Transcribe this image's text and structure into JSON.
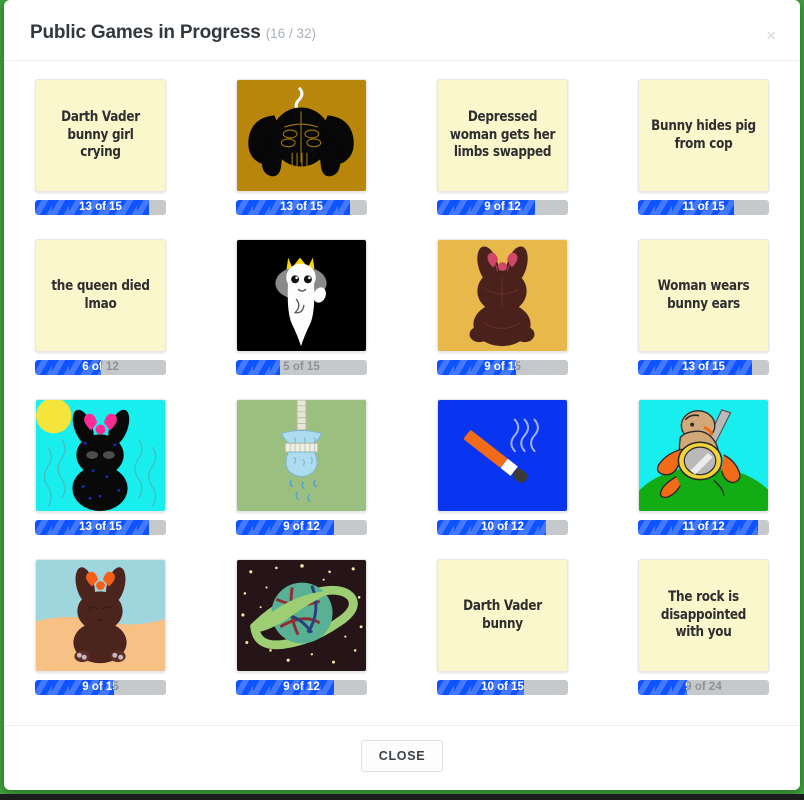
{
  "header": {
    "title": "Public Games in Progress",
    "count": "(16 / 32)",
    "close_icon": "close-icon",
    "close_icon_glyph": "×"
  },
  "footer": {
    "close_label": "CLOSE"
  },
  "colors": {
    "progress_fill": "#0f53ff",
    "progress_track": "#c6c9cc",
    "card_paper": "#fbf7cd",
    "title_text": "#32383e",
    "count_text": "#a9b0b7",
    "page_background": "#3fa13f"
  },
  "cards": [
    {
      "kind": "text",
      "text": "Darth Vader bunny girl crying",
      "progress_label": "13 of 15",
      "done": 13,
      "total": 15
    },
    {
      "kind": "drawing",
      "art": "spider-bomb",
      "progress_label": "13 of 15",
      "done": 13,
      "total": 15
    },
    {
      "kind": "text",
      "text": "Depressed woman gets her limbs swapped",
      "progress_label": "9 of 12",
      "done": 9,
      "total": 12
    },
    {
      "kind": "text",
      "text": "Bunny hides pig from cop",
      "progress_label": "11 of 15",
      "done": 11,
      "total": 15
    },
    {
      "kind": "text",
      "text": "the queen died lmao",
      "progress_label": "6 of 12",
      "done": 6,
      "total": 12
    },
    {
      "kind": "drawing",
      "art": "crowned-ghost",
      "progress_label": "5 of 15",
      "done": 5,
      "total": 15
    },
    {
      "kind": "drawing",
      "art": "chocolate-bunny-gold",
      "progress_label": "9 of 15",
      "done": 9,
      "total": 15
    },
    {
      "kind": "text",
      "text": "Woman wears bunny ears",
      "progress_label": "13 of 15",
      "done": 13,
      "total": 15
    },
    {
      "kind": "drawing",
      "art": "vader-bunny-sun",
      "progress_label": "13 of 15",
      "done": 13,
      "total": 15
    },
    {
      "kind": "drawing",
      "art": "shower-head",
      "progress_label": "9 of 12",
      "done": 9,
      "total": 12
    },
    {
      "kind": "drawing",
      "art": "lit-cigarette",
      "progress_label": "10 of 12",
      "done": 10,
      "total": 12
    },
    {
      "kind": "drawing",
      "art": "warrior-on-hill",
      "progress_label": "11 of 12",
      "done": 11,
      "total": 12
    },
    {
      "kind": "drawing",
      "art": "bunny-on-sand",
      "progress_label": "9 of 15",
      "done": 9,
      "total": 15
    },
    {
      "kind": "drawing",
      "art": "ringed-planet",
      "progress_label": "9 of 12",
      "done": 9,
      "total": 12
    },
    {
      "kind": "text",
      "text": "Darth Vader bunny",
      "progress_label": "10 of 15",
      "done": 10,
      "total": 15
    },
    {
      "kind": "text",
      "text": "The rock is disappointed with you",
      "progress_label": "9 of 24",
      "done": 9,
      "total": 24
    }
  ]
}
